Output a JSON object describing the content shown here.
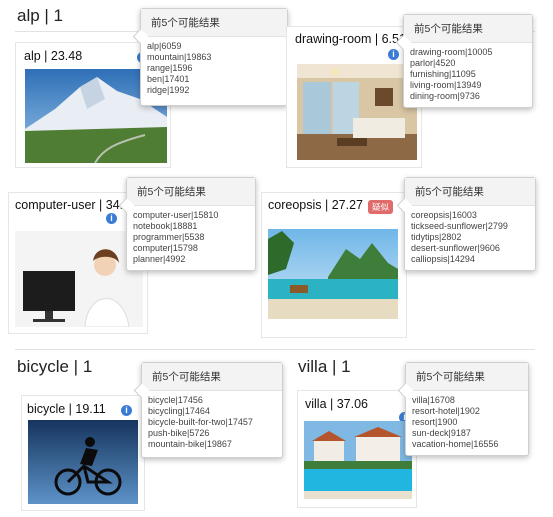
{
  "popover_title": "前5个可能结果",
  "sections": [
    {
      "heading": "alp | 1"
    },
    {
      "heading": "bicycle | 1"
    },
    {
      "heading": "villa | 1"
    }
  ],
  "cards": [
    {
      "id": "alp",
      "title": "alp | 23.48",
      "badge": "i",
      "results": [
        "alp|6059",
        "mountain|19863",
        "range|1596",
        "ben|17401",
        "ridge|1992"
      ]
    },
    {
      "id": "drawing-room",
      "title": "drawing-room | 6.51",
      "badge": "i",
      "results": [
        "drawing-room|10005",
        "parlor|4520",
        "furnishing|11095",
        "living-room|13949",
        "dining-room|9736"
      ]
    },
    {
      "id": "computer-user",
      "title": "computer-user | 34.8",
      "badge": "i",
      "results": [
        "computer-user|15810",
        "notebook|18881",
        "programmer|5538",
        "computer|15798",
        "planner|4992"
      ]
    },
    {
      "id": "coreopsis",
      "title": "coreopsis | 27.27",
      "badge": "疑似",
      "results": [
        "coreopsis|16003",
        "tickseed-sunflower|2799",
        "tidytips|2802",
        "desert-sunflower|9606",
        "calliopsis|14294"
      ]
    },
    {
      "id": "bicycle",
      "title": "bicycle | 19.11",
      "badge": "i",
      "results": [
        "bicycle|17456",
        "bicycling|17464",
        "bicycle-built-for-two|17457",
        "push-bike|5726",
        "mountain-bike|19867"
      ]
    },
    {
      "id": "villa",
      "title": "villa | 37.06",
      "badge": "i",
      "results": [
        "villa|16708",
        "resort-hotel|1902",
        "resort|1900",
        "sun-deck|9187",
        "vacation-home|16556"
      ]
    }
  ]
}
